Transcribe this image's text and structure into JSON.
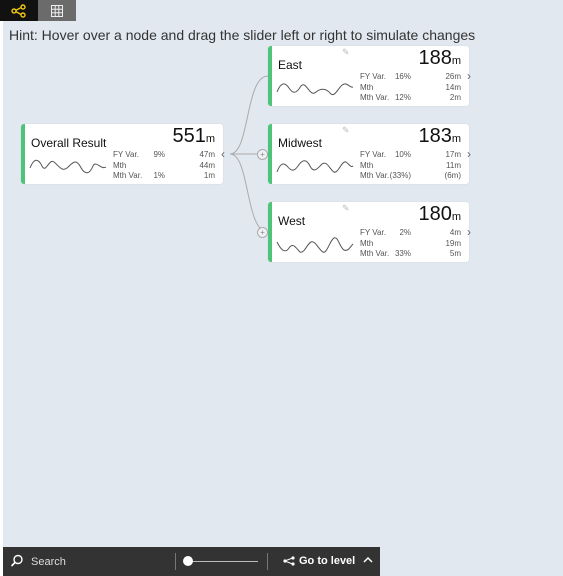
{
  "toolbar": {
    "active_view": "tree",
    "views": [
      "tree-view-icon",
      "grid-view-icon"
    ]
  },
  "hint": "Hint: Hover over a node and drag the slider left or right to simulate changes",
  "root": {
    "name": "Overall Result",
    "value": "551",
    "unit": "m",
    "fy_var_label": "FY Var.",
    "fy_var_pct": "9%",
    "fy_var_amt": "47m",
    "mth_label": "Mth",
    "mth_amt": "44m",
    "mth_var_label": "Mth Var.",
    "mth_var_pct": "1%",
    "mth_var_amt": "1m"
  },
  "children": [
    {
      "name": "East",
      "value": "188",
      "unit": "m",
      "fy_var_label": "FY Var.",
      "fy_var_pct": "16%",
      "fy_var_amt": "26m",
      "mth_label": "Mth",
      "mth_amt": "14m",
      "mth_var_label": "Mth Var.",
      "mth_var_pct": "12%",
      "mth_var_amt": "2m"
    },
    {
      "name": "Midwest",
      "value": "183",
      "unit": "m",
      "fy_var_label": "FY Var.",
      "fy_var_pct": "10%",
      "fy_var_amt": "17m",
      "mth_label": "Mth",
      "mth_amt": "11m",
      "mth_var_label": "Mth Var.",
      "mth_var_pct": "(33%)",
      "mth_var_amt": "(6m)"
    },
    {
      "name": "West",
      "value": "180",
      "unit": "m",
      "fy_var_label": "FY Var.",
      "fy_var_pct": "2%",
      "fy_var_amt": "4m",
      "mth_label": "Mth",
      "mth_amt": "19m",
      "mth_var_label": "Mth Var.",
      "mth_var_pct": "33%",
      "mth_var_amt": "5m"
    }
  ],
  "bottom_bar": {
    "search_label": "Search",
    "goto_label": "Go to level"
  },
  "colors": {
    "accent": "#4ec47a",
    "toolbar_active_icon": "#f2c811",
    "bottom_bar": "#333333"
  }
}
